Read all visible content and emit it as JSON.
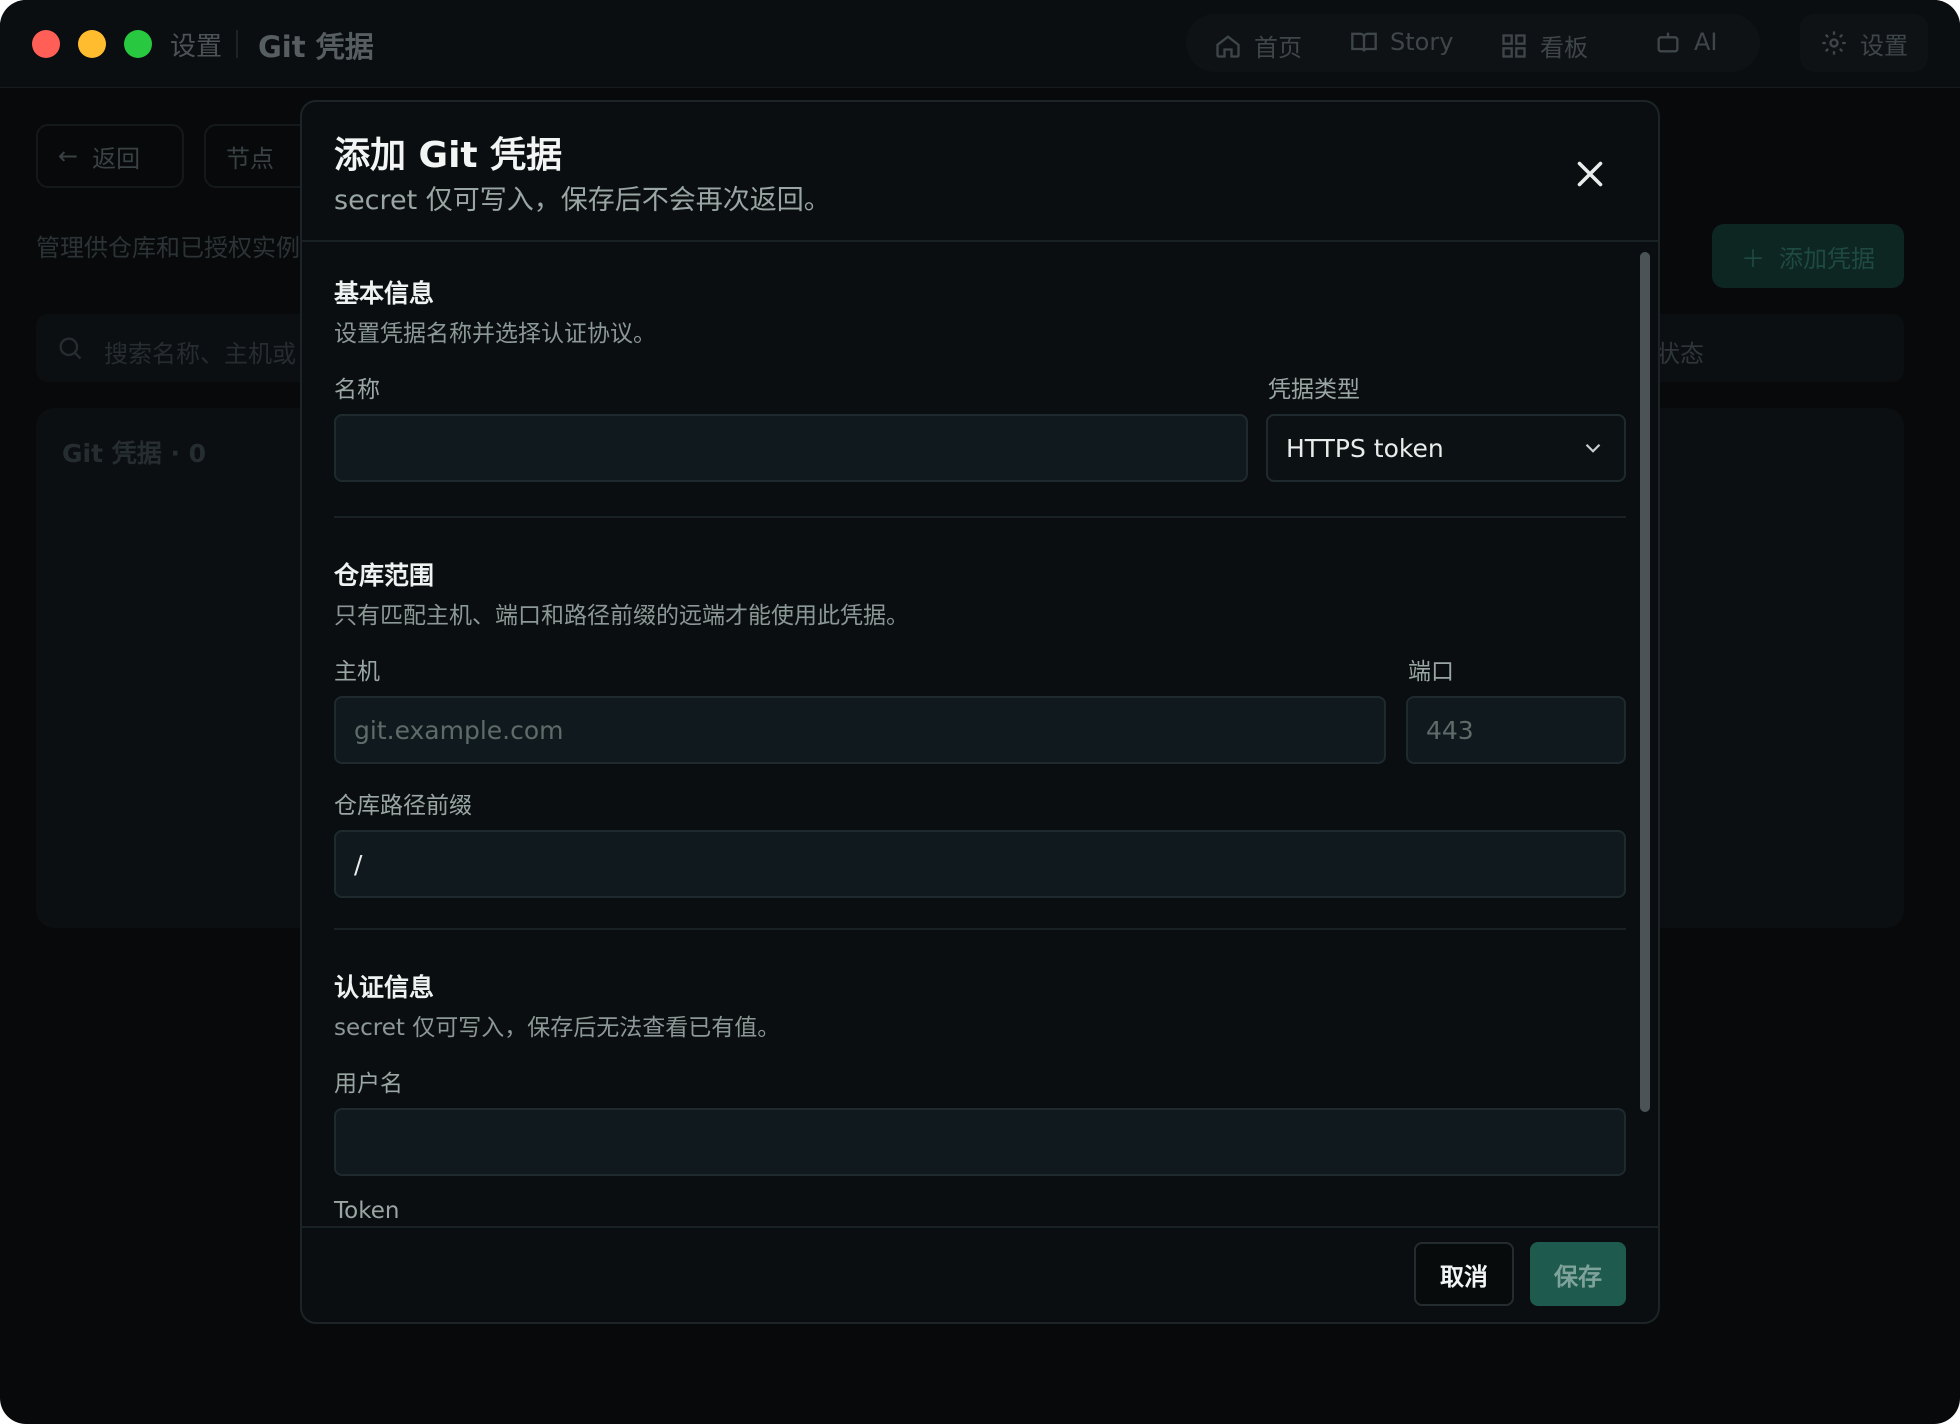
{
  "window": {
    "breadcrumb": [
      "设置",
      "Git 凭据"
    ]
  },
  "topnav": {
    "items": [
      {
        "label": "首页",
        "icon": "home-icon"
      },
      {
        "label": "Story",
        "icon": "book-icon"
      },
      {
        "label": "看板",
        "icon": "grid-icon"
      },
      {
        "label": "AI",
        "icon": "robot-icon"
      }
    ],
    "settings_label": "设置"
  },
  "background_page": {
    "back_label": "返回",
    "nodes_label": "节点",
    "description": "管理供仓库和已授权实例",
    "add_button": "添加凭据",
    "search_placeholder": "搜索名称、主机或",
    "status_filter": "状态",
    "panel_title": "Git 凭据 · 0"
  },
  "modal": {
    "title": "添加 Git 凭据",
    "subtitle": "secret 仅可写入，保存后不会再次返回。",
    "basic": {
      "title": "基本信息",
      "desc": "设置凭据名称并选择认证协议。",
      "name_label": "名称",
      "name_value": "",
      "type_label": "凭据类型",
      "type_value": "HTTPS token"
    },
    "scope": {
      "title": "仓库范围",
      "desc": "只有匹配主机、端口和路径前缀的远端才能使用此凭据。",
      "host_label": "主机",
      "host_placeholder": "git.example.com",
      "port_label": "端口",
      "port_placeholder": "443",
      "path_label": "仓库路径前缀",
      "path_value": "/"
    },
    "auth": {
      "title": "认证信息",
      "desc": "secret 仅可写入，保存后无法查看已有值。",
      "username_label": "用户名",
      "username_value": "",
      "token_label": "Token"
    },
    "cancel_label": "取消",
    "save_label": "保存"
  },
  "colors": {
    "accent": "#1f5a4f",
    "close_red": "#ff5f57",
    "minimize_yellow": "#febc2e",
    "zoom_green": "#28c840"
  }
}
